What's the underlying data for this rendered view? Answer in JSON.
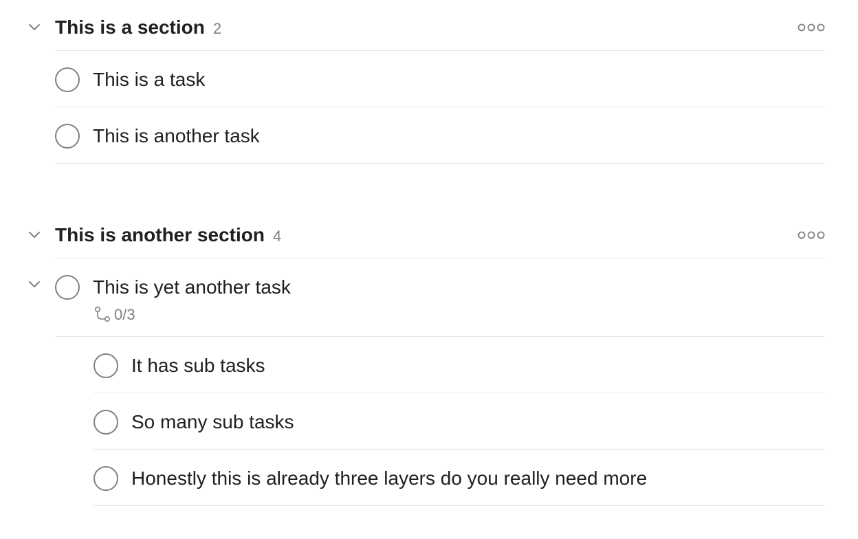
{
  "sections": [
    {
      "title": "This is a section",
      "count": "2",
      "tasks": [
        {
          "label": "This is a task"
        },
        {
          "label": "This is another task"
        }
      ]
    },
    {
      "title": "This is another section",
      "count": "4",
      "tasks": [
        {
          "label": "This is yet another task",
          "subtask_progress": "0/3",
          "subtasks": [
            {
              "label": "It has sub tasks"
            },
            {
              "label": "So many sub tasks"
            },
            {
              "label": "Honestly this is already three layers do you really need more"
            }
          ]
        }
      ]
    }
  ],
  "icons": {
    "collapse": "chevron-down-icon",
    "more": "more-options-icon",
    "subtasks": "subtask-icon"
  },
  "colors": {
    "text": "#202020",
    "muted": "#808080",
    "divider": "#e6e6e6"
  }
}
